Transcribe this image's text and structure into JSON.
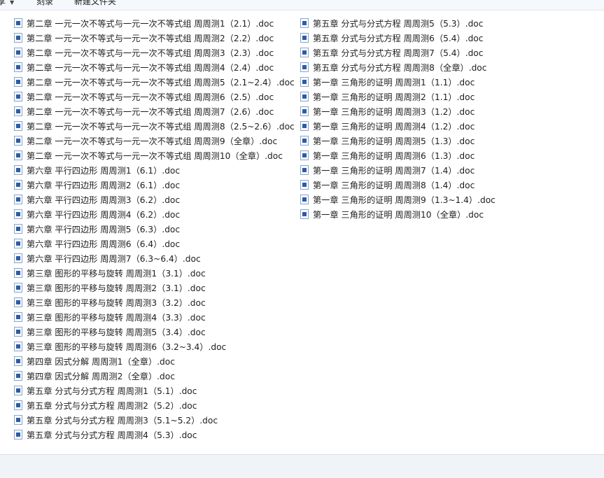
{
  "toolbar": {
    "organize_label": "享",
    "burn_label": "刻录",
    "new_folder_label": "新建文件夹"
  },
  "files_left": [
    "第二章 一元一次不等式与一元一次不等式组 周周测1（2.1）.doc",
    "第二章 一元一次不等式与一元一次不等式组 周周测2（2.2）.doc",
    "第二章 一元一次不等式与一元一次不等式组 周周测3（2.3）.doc",
    "第二章 一元一次不等式与一元一次不等式组 周周测4（2.4）.doc",
    "第二章 一元一次不等式与一元一次不等式组 周周测5（2.1~2.4）.doc",
    "第二章 一元一次不等式与一元一次不等式组 周周测6（2.5）.doc",
    "第二章 一元一次不等式与一元一次不等式组 周周测7（2.6）.doc",
    "第二章 一元一次不等式与一元一次不等式组 周周测8（2.5~2.6）.doc",
    "第二章 一元一次不等式与一元一次不等式组 周周测9（全章）.doc",
    "第二章 一元一次不等式与一元一次不等式组 周周测10（全章）.doc",
    "第六章 平行四边形 周周测1（6.1）.doc",
    "第六章 平行四边形 周周测2（6.1）.doc",
    "第六章 平行四边形 周周测3（6.2）.doc",
    "第六章 平行四边形 周周测4（6.2）.doc",
    "第六章 平行四边形 周周测5（6.3）.doc",
    "第六章 平行四边形 周周测6（6.4）.doc",
    "第六章 平行四边形 周周测7（6.3~6.4）.doc",
    "第三章 图形的平移与旋转 周周测1（3.1）.doc",
    "第三章 图形的平移与旋转 周周测2（3.1）.doc",
    "第三章 图形的平移与旋转 周周测3（3.2）.doc",
    "第三章 图形的平移与旋转 周周测4（3.3）.doc",
    "第三章 图形的平移与旋转 周周测5（3.4）.doc",
    "第三章 图形的平移与旋转 周周测6（3.2~3.4）.doc",
    "第四章 因式分解 周周测1（全章）.doc",
    "第四章 因式分解 周周测2（全章）.doc",
    "第五章 分式与分式方程 周周测1（5.1）.doc",
    "第五章 分式与分式方程 周周测2（5.2）.doc",
    "第五章 分式与分式方程 周周测3（5.1~5.2）.doc",
    "第五章 分式与分式方程 周周测4（5.3）.doc"
  ],
  "files_right": [
    "第五章 分式与分式方程 周周测5（5.3）.doc",
    "第五章 分式与分式方程 周周测6（5.4）.doc",
    "第五章 分式与分式方程 周周测7（5.4）.doc",
    "第五章 分式与分式方程 周周测8（全章）.doc",
    "第一章 三角形的证明 周周测1（1.1）.doc",
    "第一章 三角形的证明 周周测2（1.1）.doc",
    "第一章 三角形的证明 周周测3（1.2）.doc",
    "第一章 三角形的证明 周周测4（1.2）.doc",
    "第一章 三角形的证明 周周测5（1.3）.doc",
    "第一章 三角形的证明 周周测6（1.3）.doc",
    "第一章 三角形的证明 周周测7（1.4）.doc",
    "第一章 三角形的证明 周周测8（1.4）.doc",
    "第一章 三角形的证明 周周测9（1.3~1.4）.doc",
    "第一章 三角形的证明 周周测10（全章）.doc"
  ],
  "file_icon": "word-document-icon"
}
